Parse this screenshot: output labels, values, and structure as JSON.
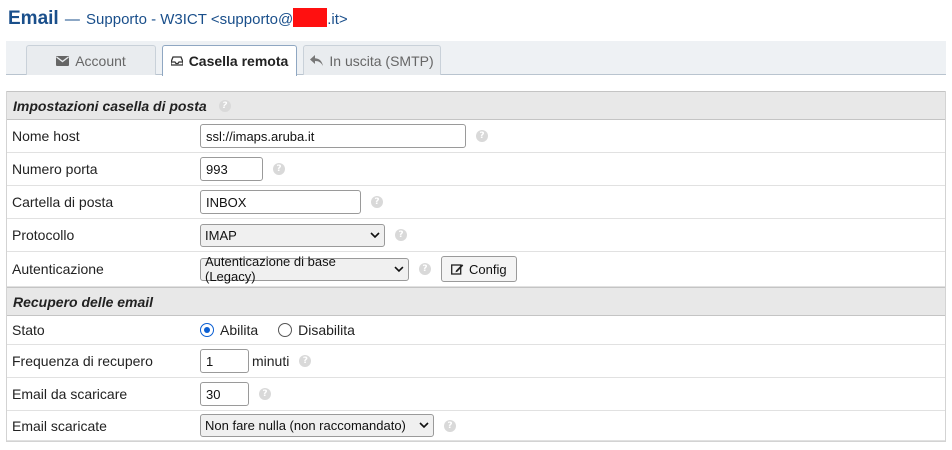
{
  "header": {
    "app_title": "Email",
    "dash": "—",
    "account_prefix": "Supporto - W3ICT <supporto@",
    "account_suffix": ".it>"
  },
  "tabs": [
    {
      "label": "Account",
      "icon": "envelope-icon",
      "active": false
    },
    {
      "label": "Casella remota",
      "icon": "inbox-tray-icon",
      "active": true
    },
    {
      "label": "In uscita (SMTP)",
      "icon": "reply-arrow-icon",
      "active": false
    }
  ],
  "sections": {
    "mailbox": {
      "title": "Impostazioni casella di posta"
    },
    "fetch": {
      "title": "Recupero delle email"
    }
  },
  "fields": {
    "host": {
      "label": "Nome host",
      "value": "ssl://imaps.aruba.it"
    },
    "port": {
      "label": "Numero porta",
      "value": "993"
    },
    "folder": {
      "label": "Cartella di posta",
      "value": "INBOX"
    },
    "protocol": {
      "label": "Protocollo",
      "value": "IMAP"
    },
    "auth": {
      "label": "Autenticazione",
      "value": "Autenticazione di base (Legacy)",
      "config_label": "Config"
    },
    "status": {
      "label": "Stato",
      "option_enable": "Abilita",
      "option_disable": "Disabilita",
      "selected": "Abilita"
    },
    "frequency": {
      "label": "Frequenza di recupero",
      "value": "1",
      "unit": "minuti"
    },
    "to_fetch": {
      "label": "Email da scaricare",
      "value": "30"
    },
    "fetched": {
      "label": "Email scaricate",
      "value": "Non fare nulla (non raccomandato)"
    }
  },
  "help_glyph": "?",
  "colors": {
    "title": "#1a4f8b",
    "redaction": "#ff1010",
    "radio_checked": "#0b5fd3",
    "section_bg": "#e8e8e8"
  }
}
